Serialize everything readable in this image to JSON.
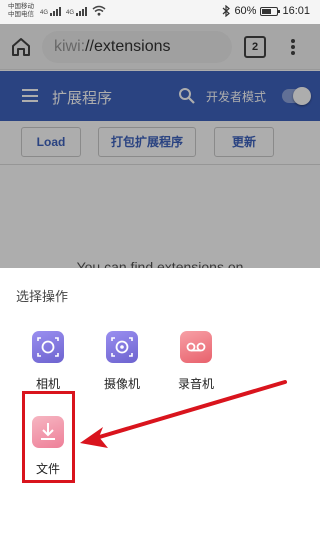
{
  "status_bar": {
    "carrier_1": "中国移动",
    "carrier_2": "中国电信",
    "net_1": "4G",
    "net_2": "4G",
    "battery_percent": "60%",
    "time": "16:01"
  },
  "browser": {
    "url_scheme": "kiwi:",
    "url_path": "//extensions",
    "tab_count": "2",
    "icons": [
      "home-icon",
      "more-vert-icon",
      "bluetooth-icon",
      "wifi-icon",
      "battery-icon"
    ]
  },
  "extensions_page": {
    "title": "扩展程序",
    "developer_mode_label": "开发者模式",
    "developer_mode_on": true,
    "buttons": {
      "load": "Load",
      "pack": "打包扩展程序",
      "update": "更新"
    },
    "empty_text": "You can find extensions on",
    "accent_color": "#3f63bf"
  },
  "sheet": {
    "title": "选择操作",
    "actions": [
      {
        "label": "相机",
        "icon": "camera-icon"
      },
      {
        "label": "摄像机",
        "icon": "camcorder-icon"
      },
      {
        "label": "录音机",
        "icon": "voicemail-icon"
      },
      {
        "label": "文件",
        "icon": "download-file-icon"
      }
    ],
    "highlight_color": "#d9141d"
  }
}
